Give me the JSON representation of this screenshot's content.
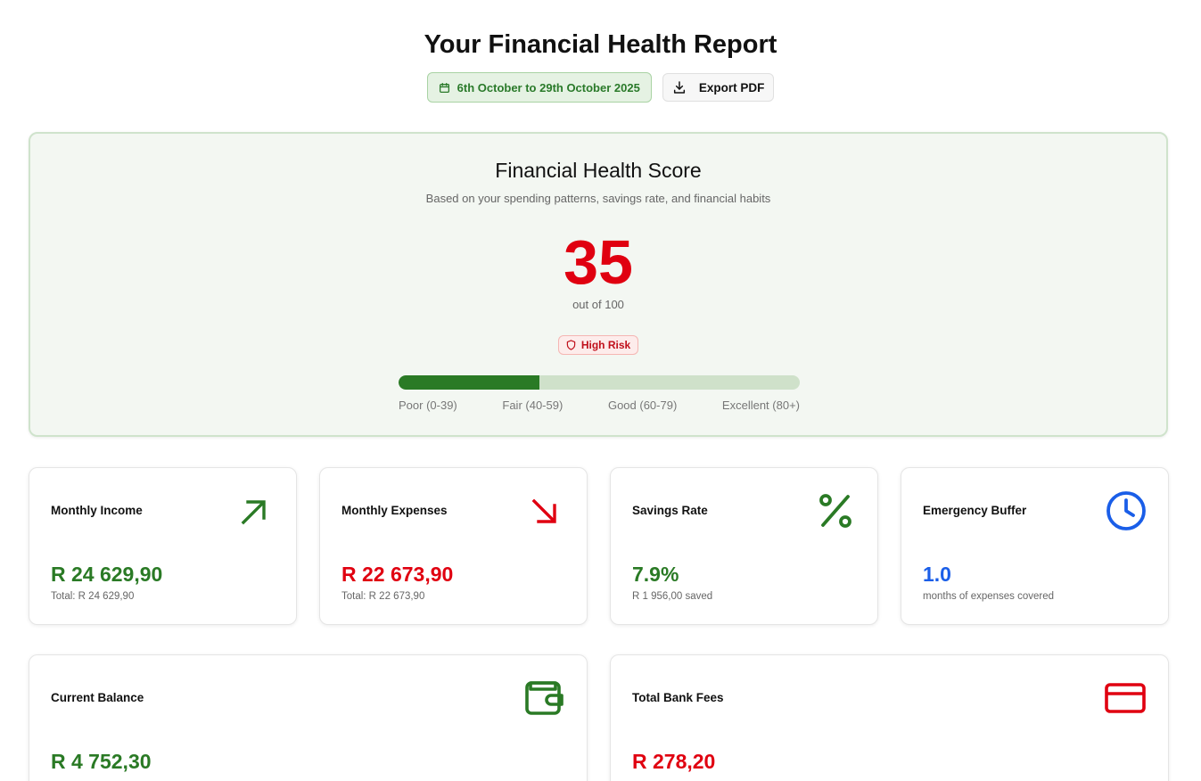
{
  "header": {
    "title": "Your Financial Health Report",
    "date_range": "6th October to 29th October 2025",
    "export_label": "Export PDF"
  },
  "score": {
    "title": "Financial Health Score",
    "subtitle": "Based on your spending patterns, savings rate, and financial habits",
    "value": "35",
    "out_of": "out of 100",
    "risk_label": "High Risk",
    "progress_percent": 35,
    "legend": [
      "Poor (0-39)",
      "Fair (40-59)",
      "Good (60-79)",
      "Excellent (80+)"
    ]
  },
  "metrics": {
    "income": {
      "label": "Monthly Income",
      "value": "R 24 629,90",
      "note": "Total: R 24 629,90",
      "icon": "arrow-up-right-icon"
    },
    "expenses": {
      "label": "Monthly Expenses",
      "value": "R 22 673,90",
      "note": "Total: R 22 673,90",
      "icon": "arrow-down-right-icon"
    },
    "savings": {
      "label": "Savings Rate",
      "value": "7.9%",
      "note": "R 1 956,00 saved",
      "icon": "percent-icon"
    },
    "emergency": {
      "label": "Emergency Buffer",
      "value": "1.0",
      "note": "months of expenses covered",
      "icon": "clock-icon"
    },
    "balance": {
      "label": "Current Balance",
      "value": "R 4 752,30",
      "icon": "wallet-icon"
    },
    "fees": {
      "label": "Total Bank Fees",
      "value": "R 278,20",
      "icon": "credit-card-icon"
    }
  },
  "colors": {
    "green": "#2a7a25",
    "red": "#e00010",
    "blue": "#1a5ee8",
    "risk_red": "#c0101b"
  }
}
